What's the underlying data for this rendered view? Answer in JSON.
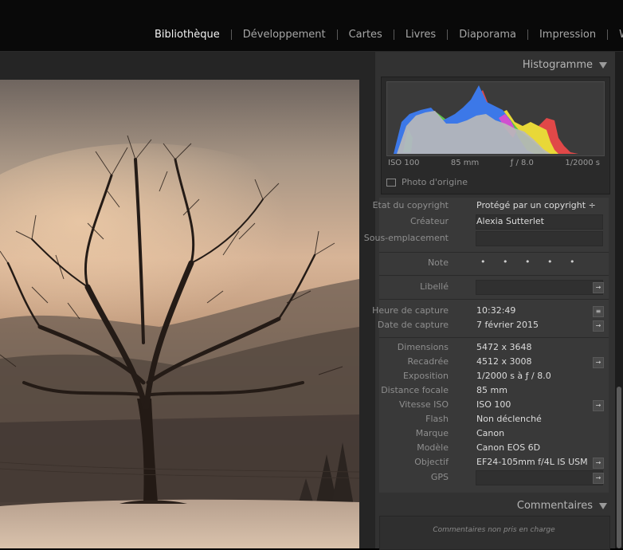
{
  "modules": [
    "Bibliothèque",
    "Développement",
    "Cartes",
    "Livres",
    "Diaporama",
    "Impression",
    "Web"
  ],
  "active_module": "Bibliothèque",
  "histogram": {
    "title": "Histogramme",
    "iso": "ISO 100",
    "focal": "85 mm",
    "aperture": "ƒ / 8.0",
    "shutter": "1/2000 s",
    "original_photo_label": "Photo d'origine"
  },
  "metadata": {
    "copyright_status": {
      "label": "Etat du copyright",
      "value": "Protégé par un copyright ÷"
    },
    "creator": {
      "label": "Créateur",
      "value": "Alexia Sutterlet"
    },
    "sublocation": {
      "label": "Sous-emplacement",
      "value": ""
    },
    "rating": {
      "label": "Note",
      "value": "• • • • •"
    },
    "label": {
      "label": "Libellé",
      "value": ""
    },
    "capture_time": {
      "label": "Heure de capture",
      "value": "10:32:49"
    },
    "capture_date": {
      "label": "Date de capture",
      "value": "7 février 2015"
    },
    "dimensions": {
      "label": "Dimensions",
      "value": "5472 x 3648"
    },
    "cropped": {
      "label": "Recadrée",
      "value": "4512 x 3008"
    },
    "exposure": {
      "label": "Exposition",
      "value": "1/2000 s à ƒ / 8.0"
    },
    "focal_length": {
      "label": "Distance focale",
      "value": "85 mm"
    },
    "iso_speed": {
      "label": "Vitesse ISO",
      "value": "ISO 100"
    },
    "flash": {
      "label": "Flash",
      "value": "Non déclenché"
    },
    "make": {
      "label": "Marque",
      "value": "Canon"
    },
    "model": {
      "label": "Modèle",
      "value": "Canon EOS 6D"
    },
    "lens": {
      "label": "Objectif",
      "value": "EF24-105mm f/4L IS USM"
    },
    "gps": {
      "label": "GPS",
      "value": ""
    }
  },
  "comments": {
    "title": "Commentaires",
    "message": "Commentaires non pris en charge"
  },
  "icons": {
    "panel_collapse": "triangle-down-icon",
    "go_arrow": "arrow-right-icon",
    "list": "list-icon"
  },
  "colors": {
    "accent_text": "#f2f2f2",
    "panel_bg": "#323232",
    "field_bg": "#393939"
  }
}
